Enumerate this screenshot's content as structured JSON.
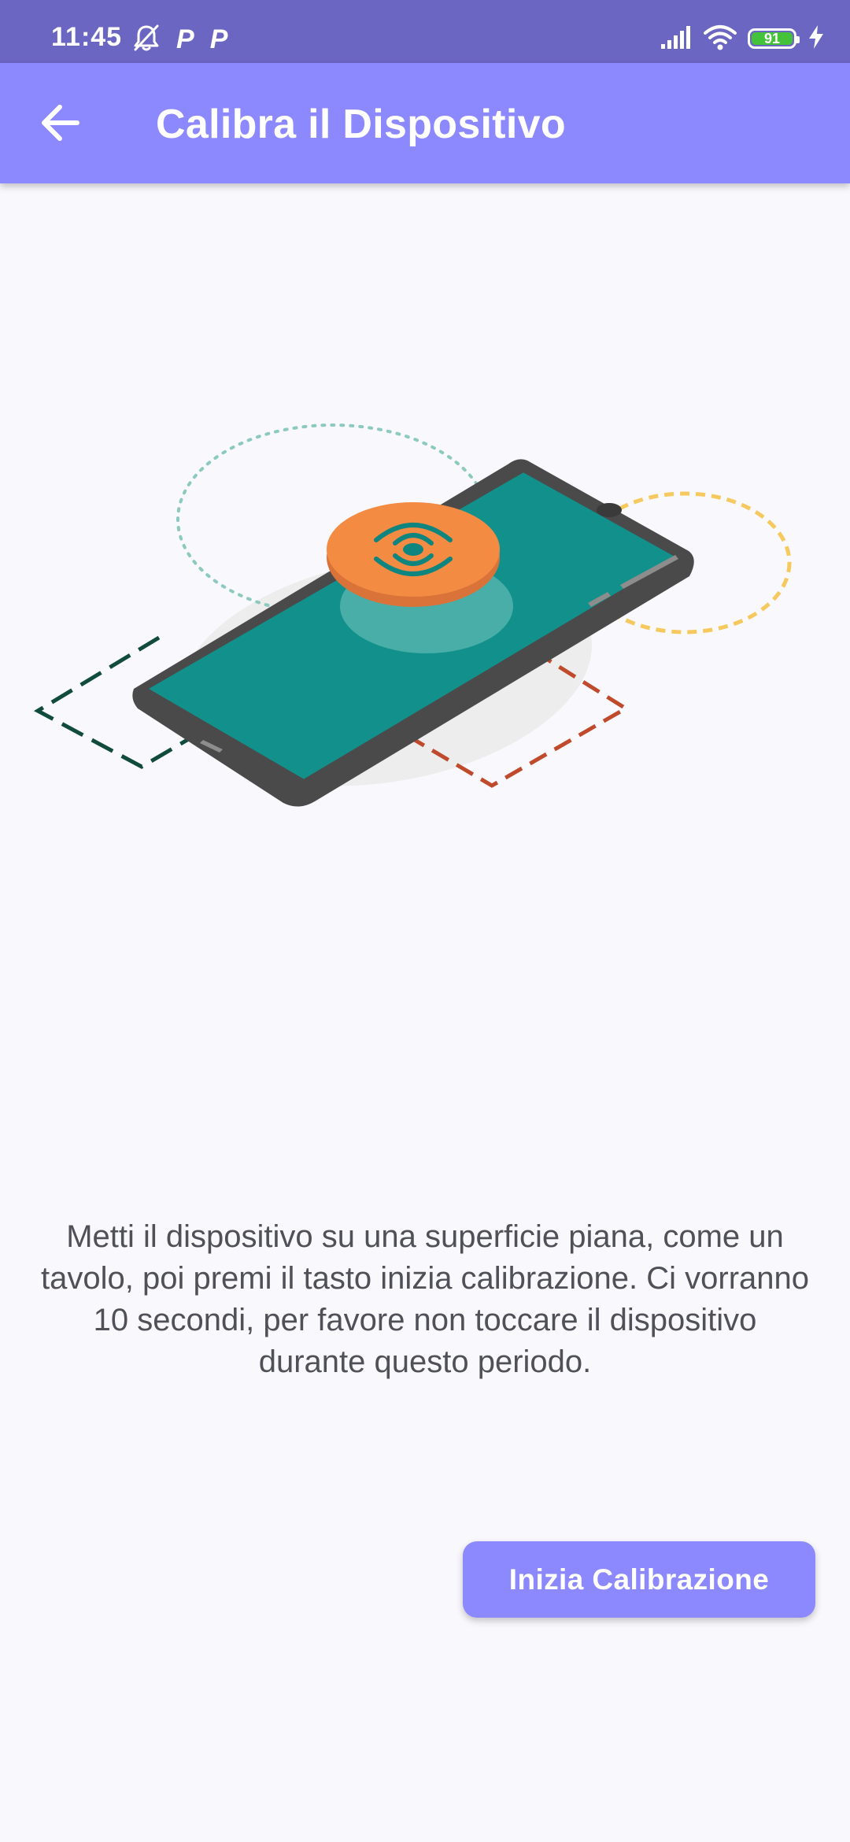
{
  "status_bar": {
    "time": "11:45",
    "left_icons": [
      "bell-off-icon",
      "p-icon",
      "p-icon"
    ],
    "p_label": "P",
    "battery_level": "91",
    "right_icons": [
      "signal-icon",
      "wifi-icon",
      "battery-icon",
      "charging-icon"
    ]
  },
  "app_bar": {
    "back_icon": "arrow-left-icon",
    "title": "Calibra il Dispositivo"
  },
  "illustration": {
    "name": "phone-calibration-illustration",
    "colors": {
      "phone_body": "#4a4a4a",
      "phone_screen": "#12908b",
      "disc": "#f48b42",
      "disc_icon": "#0f857f",
      "green_dashes": "#114b3e",
      "red_dashes": "#c04a2c",
      "teal_dots": "#8cc9bf",
      "yellow_dashes": "#f6c95f",
      "shadow": "#ededed"
    }
  },
  "description": "Metti il dispositivo su una superficie piana, come un tavolo, poi premi il tasto inizia calibrazione. Ci vorranno 10 secondi, per favore non toccare il dispositivo durante questo periodo.",
  "start_button": {
    "label": "Inizia Calibrazione"
  },
  "colors": {
    "status_bar": "#6c66c3",
    "app_bar": "#8c88fd",
    "background": "#f9f8fd",
    "button": "#8c88fd",
    "battery_fill": "#43c23a"
  }
}
